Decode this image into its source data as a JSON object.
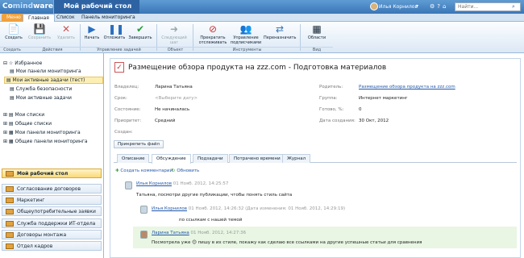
{
  "header": {
    "logo_prefix": "Co",
    "logo_mid": "mind",
    "logo_suffix": "ware",
    "app_title": "Мой рабочий стол",
    "user_name": "Илья Корнилов",
    "search_placeholder": "Найти..."
  },
  "tabs": [
    {
      "label": "Меню"
    },
    {
      "label": "Главная"
    },
    {
      "label": "Список"
    },
    {
      "label": "Панель мониторинга"
    }
  ],
  "ribbon": {
    "buttons": [
      {
        "label": "Создать",
        "icon": "new-doc-icon"
      },
      {
        "label": "Сохранить",
        "icon": "save-icon"
      },
      {
        "label": "Удалить",
        "icon": "delete-icon"
      },
      {
        "label": "Начать",
        "icon": "play-icon"
      },
      {
        "label": "Отложить",
        "icon": "pause-icon"
      },
      {
        "label": "Завершить",
        "icon": "check-icon"
      },
      {
        "label": "Следующий шаг",
        "icon": "next-step-icon"
      },
      {
        "label": "Прекратить отслеживать",
        "icon": "stop-watch-icon"
      },
      {
        "label": "Управление подписчиками",
        "icon": "subscribers-icon"
      },
      {
        "label": "Переназначить",
        "icon": "reassign-icon"
      },
      {
        "label": "Области",
        "icon": "areas-icon"
      }
    ],
    "groups": [
      "Создать",
      "Действия",
      "Управление задачей",
      "Объект",
      "Инструменты",
      "Вид"
    ]
  },
  "sidebar": {
    "favorites_label": "Избранное",
    "items": [
      {
        "label": "Мои панели мониторинга"
      },
      {
        "label": "Мои активные задачи (тест)"
      },
      {
        "label": "Служба безопасности"
      },
      {
        "label": "Мои активные задачи"
      }
    ],
    "sections": [
      {
        "label": "Мои списки"
      },
      {
        "label": "Общие списки"
      },
      {
        "label": "Мои панели мониторинга"
      },
      {
        "label": "Общие панели мониторинга"
      }
    ],
    "workspaces": [
      {
        "label": "Мой рабочий стол"
      },
      {
        "label": "Согласование договоров"
      },
      {
        "label": "Маркетинг"
      },
      {
        "label": "Общеупотребительные заявки"
      },
      {
        "label": "Служба поддержки ИТ-отдела"
      },
      {
        "label": "Договоры монтажа"
      },
      {
        "label": "Отдел кадров"
      }
    ]
  },
  "task": {
    "title": "Размещение обзора продукта на zzz.com - Подготовка материалов",
    "fields": [
      {
        "label": "Владелец:",
        "value": "Ларина Татьяна"
      },
      {
        "label": "Срок:",
        "value": "<Выберите дату>"
      },
      {
        "label": "Состояние:",
        "value": "Не начиналась"
      },
      {
        "label": "Приоритет:",
        "value": "Средний"
      },
      {
        "label": "Создан:",
        "value": ""
      }
    ],
    "right_fields": [
      {
        "label": "Родитель:",
        "value": "Размещение обзора продукта на zzz.com"
      },
      {
        "label": "Группа:",
        "value": "Интернет маркетинг"
      },
      {
        "label": "Готово, %:",
        "value": "0"
      },
      {
        "label": "Дата создания:",
        "value": "30 Окт, 2012"
      }
    ],
    "attach_label": "Прикрепить файл",
    "tabs": [
      "Описание",
      "Обсуждение",
      "Подзадачи",
      "Потрачено времени",
      "Журнал"
    ],
    "add_comment": "Создать комментарий",
    "refresh": "Обновить"
  },
  "comments": [
    {
      "author": "Илья Корнилов",
      "date": "01 Нояб. 2012, 14:25:57",
      "edited": "",
      "text": "Татьяна, посмотри другие публикации, чтобы понять стиль сайта"
    },
    {
      "author": "Илья Корнилов",
      "date": "01 Нояб. 2012, 14:26:32",
      "edited": "(Дата изменения: 01 Нояб. 2012, 14:29:19)",
      "text": "по ссылкам с нашей темой"
    },
    {
      "author": "Ларина Татьяна",
      "date": "01 Нояб. 2012, 14:27:36",
      "edited": "",
      "text": "Посмотрела уже 😊 пишу в их стиле, покажу как сделаю все ссылками на другие успешные статьи для сравнения"
    }
  ]
}
